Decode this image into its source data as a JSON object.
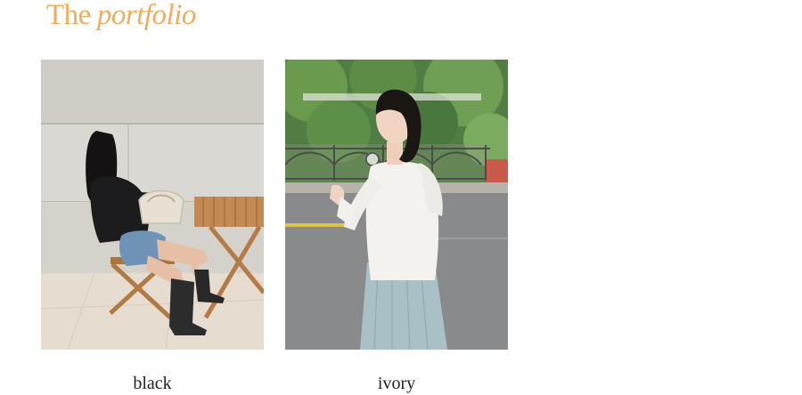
{
  "heading": {
    "plain": "The",
    "italic": "portfolio",
    "color": "#f2ac5b"
  },
  "items": [
    {
      "label": "black"
    },
    {
      "label": "ivory"
    }
  ]
}
